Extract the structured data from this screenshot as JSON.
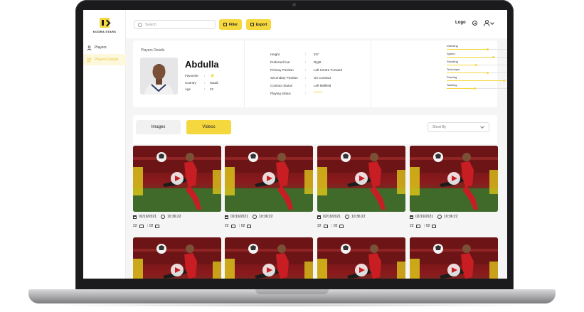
{
  "app": {
    "brand": "KOORA STARS",
    "top_logo": "Logo",
    "search_placeholder": "Search",
    "filter_label": "Filter",
    "export_label": "Export"
  },
  "sidebar": {
    "items": [
      {
        "label": "Players",
        "active": false
      },
      {
        "label": "Players Details",
        "active": true
      }
    ]
  },
  "player": {
    "section_title": "Players Details",
    "name": "Abdulla",
    "favourite_label": "Favourite",
    "country_label": "Country",
    "country": "Saudi",
    "age_label": "Age",
    "age": "22",
    "stats": [
      {
        "label": "Height",
        "value": "5'6\""
      },
      {
        "label": "Preferred foot",
        "value": "Right"
      },
      {
        "label": "Primary Position",
        "value": "Left Centre Forward"
      },
      {
        "label": "Secondary Position",
        "value": "On Contract"
      },
      {
        "label": "Contract Status",
        "value": "Left Midfield"
      },
      {
        "label": "Playing Status",
        "value": ""
      }
    ],
    "skills": [
      {
        "label": "Dribbling",
        "level": 0.66
      },
      {
        "label": "Speed",
        "level": 0.75
      },
      {
        "label": "Shooting",
        "level": 0.48
      },
      {
        "label": "Technique",
        "level": 0.66
      },
      {
        "label": "Passing",
        "level": 0.92
      },
      {
        "label": "Tackling",
        "level": 0.45
      }
    ]
  },
  "tabs": {
    "images": "Images",
    "videos": "Videos",
    "sort_placeholder": "Short By"
  },
  "videos": [
    {
      "date": "02/19/2021",
      "time": "10:36:22",
      "likes": "22",
      "dislikes": "02"
    },
    {
      "date": "02/19/2021",
      "time": "10:36:22",
      "likes": "22",
      "dislikes": "02"
    },
    {
      "date": "02/19/2021",
      "time": "10:36:22",
      "likes": "22",
      "dislikes": "02"
    },
    {
      "date": "02/19/2021",
      "time": "10:36:22",
      "likes": "22",
      "dislikes": "02"
    },
    {
      "date": "",
      "time": "",
      "likes": "",
      "dislikes": ""
    },
    {
      "date": "",
      "time": "",
      "likes": "",
      "dislikes": ""
    },
    {
      "date": "",
      "time": "",
      "likes": "",
      "dislikes": ""
    },
    {
      "date": "",
      "time": "",
      "likes": "",
      "dislikes": ""
    }
  ],
  "colors": {
    "accent": "#f5d73e",
    "shell": "#1b1b1d"
  }
}
